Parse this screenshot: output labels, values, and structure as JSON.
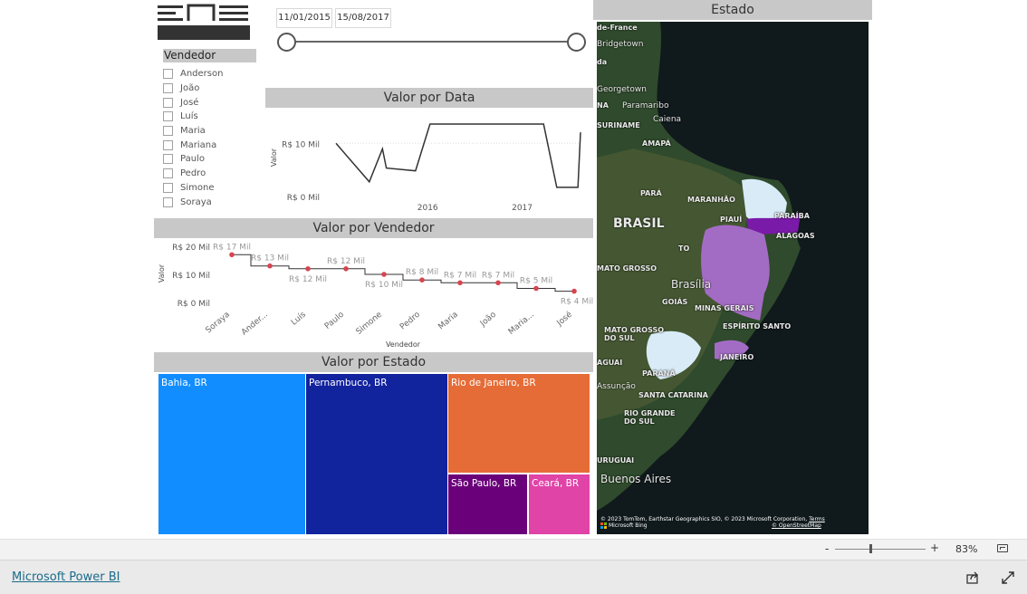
{
  "logo": {
    "text": "ENS"
  },
  "date_range": {
    "start": "11/01/2015",
    "end": "15/08/2017"
  },
  "vendedor_slicer": {
    "title": "Vendedor",
    "items": [
      "Anderson",
      "João",
      "José",
      "Luís",
      "Maria",
      "Mariana",
      "Paulo",
      "Pedro",
      "Simone",
      "Soraya"
    ]
  },
  "visual_titles": {
    "valor_por_data": "Valor por Data",
    "valor_por_vendedor": "Valor por Vendedor",
    "valor_por_estado": "Valor por Estado",
    "estado": "Estado"
  },
  "chart_data": [
    {
      "type": "line",
      "title": "Valor por Data",
      "ylabel": "Valor",
      "xlabel": "",
      "y_ticks": [
        "R$ 10 Mil",
        "R$ 0 Mil"
      ],
      "x_ticks": [
        "2016",
        "2017"
      ],
      "ylim": [
        0,
        14000
      ],
      "x_range": [
        "2015-01-11",
        "2017-08-15"
      ],
      "series": [
        {
          "x": [
            "2015-01-11",
            "2015-05-20",
            "2015-07-10",
            "2015-07-25",
            "2015-11-15",
            "2016-01-10",
            "2016-04-10",
            "2017-03-25",
            "2017-05-15",
            "2017-08-05",
            "2017-08-15"
          ],
          "y": [
            10000,
            3000,
            9000,
            5500,
            5000,
            13500,
            13500,
            13500,
            2000,
            2000,
            12000
          ]
        }
      ]
    },
    {
      "type": "line",
      "title": "Valor por Vendedor",
      "xlabel": "Vendedor",
      "ylabel": "Valor",
      "y_ticks": [
        "R$ 20 Mil",
        "R$ 10 Mil",
        "R$ 0 Mil"
      ],
      "ylim": [
        0,
        20000
      ],
      "categories": [
        "Soraya",
        "Anderson",
        "Luís",
        "Paulo",
        "Simone",
        "Pedro",
        "Maria",
        "João",
        "Mariana",
        "José"
      ],
      "category_labels": [
        "Soraya",
        "Ander...",
        "Luís",
        "Paulo",
        "Simone",
        "Pedro",
        "Maria",
        "João",
        "Maria...",
        "José"
      ],
      "values": [
        17000,
        13000,
        12000,
        12000,
        10000,
        8000,
        7000,
        7000,
        5000,
        4000
      ],
      "data_labels": [
        "R$ 17 Mil",
        "R$ 13 Mil",
        "R$ 12 Mil",
        "R$ 12 Mil",
        "R$ 10 Mil",
        "R$ 8 Mil",
        "R$ 7 Mil",
        "R$ 7 Mil",
        "R$ 5 Mil",
        "R$ 4 Mil"
      ]
    },
    {
      "type": "treemap",
      "title": "Valor por Estado",
      "items": [
        {
          "label": "Bahia, BR",
          "color": "#118dff"
        },
        {
          "label": "Pernambuco, BR",
          "color": "#12239e"
        },
        {
          "label": "Rio de Janeiro, BR",
          "color": "#e66c37"
        },
        {
          "label": "São Paulo, BR",
          "color": "#6b007b"
        },
        {
          "label": "Ceará, BR",
          "color": "#e044a7"
        }
      ]
    }
  ],
  "map": {
    "labels": [
      "de-France",
      "Bridgetown",
      "da",
      "Georgetown",
      "NA",
      "Paramaribo",
      "SURINAME",
      "Caiena",
      "AMAPÁ",
      "PARÁ",
      "MARANHÃO",
      "PIAUÍ",
      "PARAÍBA",
      "ALAGOAS",
      "BRASIL",
      "TO",
      "MATO GROSSO",
      "Brasília",
      "GOIÁS",
      "MINAS GERAIS",
      "ESPÍRITO SANTO",
      "MATO GROSSO DO SUL",
      "JANEIRO",
      "AGUAI",
      "PARANÁ",
      "Assunção",
      "SANTA CATARINA",
      "RIO GRANDE DO SUL",
      "URUGUAI",
      "Buenos Aires"
    ],
    "attribution": "© 2023 TomTom, Earthstar Geographics SIO, © 2023 Microsoft Corporation,",
    "terms": "Terms",
    "osm": "© OpenStreetMap",
    "bing": "Microsoft Bing"
  },
  "statusbar": {
    "zoom": "83%",
    "minus": "-",
    "plus": "+"
  },
  "footer": {
    "link": "Microsoft Power BI"
  }
}
